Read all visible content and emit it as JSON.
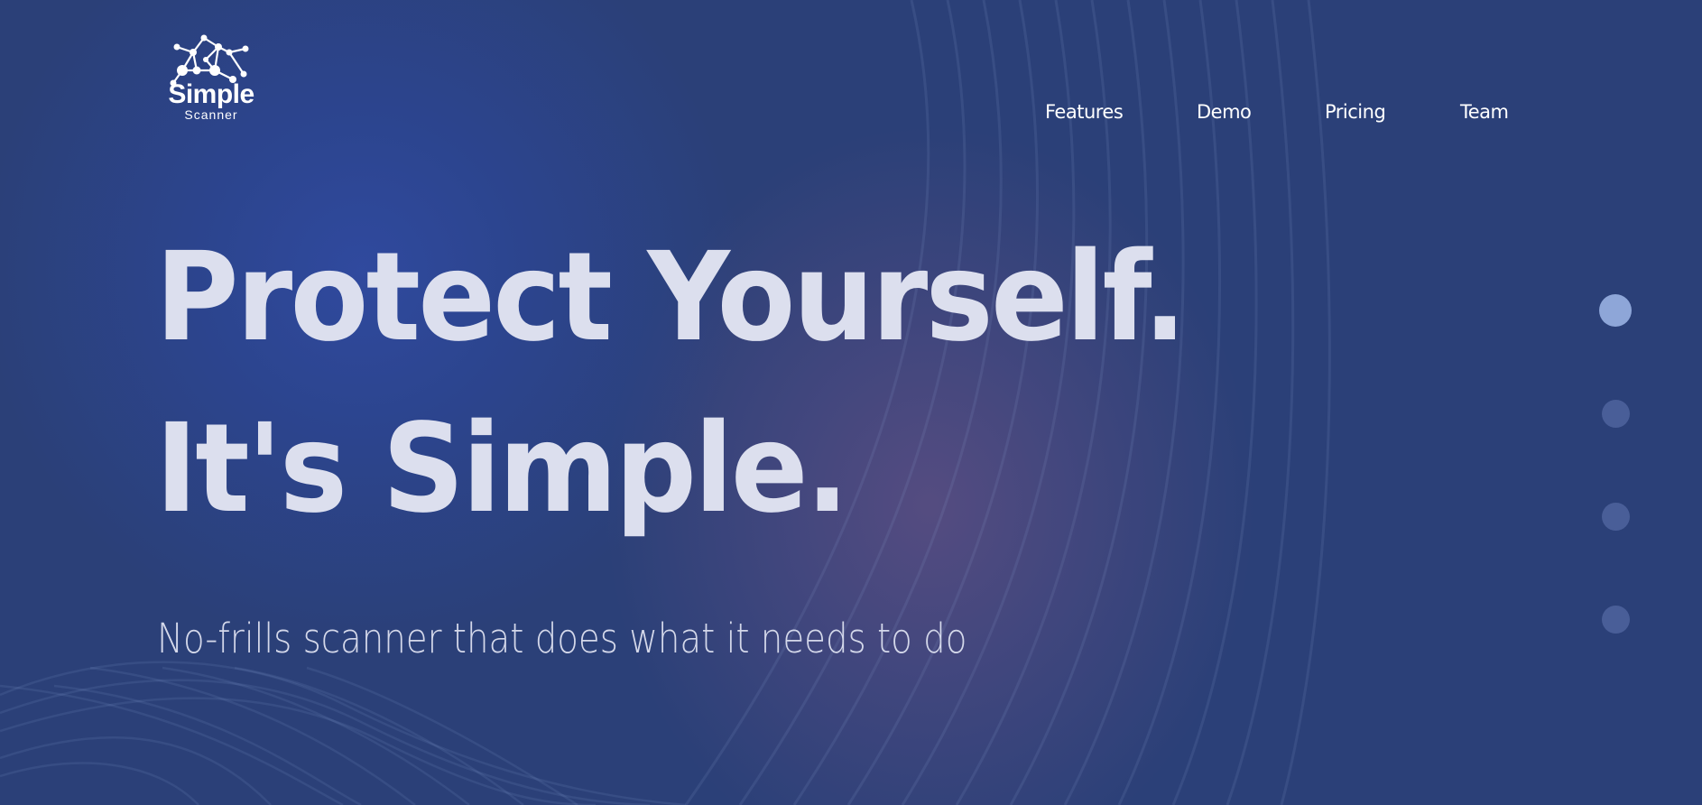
{
  "logo": {
    "name": "Simple",
    "subtitle": "Scanner",
    "icon": "network-nodes-icon"
  },
  "nav": {
    "items": [
      {
        "label": "Features"
      },
      {
        "label": "Demo"
      },
      {
        "label": "Pricing"
      },
      {
        "label": "Team"
      }
    ]
  },
  "hero": {
    "line1": "Protect Yourself.",
    "line2": "It's Simple.",
    "tagline": "No-frills scanner that does what it needs to do"
  },
  "section_indicator": {
    "count": 4,
    "active_index": 0
  },
  "colors": {
    "background": "#2b4078",
    "blue_glow": "#304aa0",
    "purple_glow": "#5c4e82",
    "text_primary": "#ffffff",
    "hero_text": "#dcdfee",
    "active_dot": "#8ea6d8"
  }
}
